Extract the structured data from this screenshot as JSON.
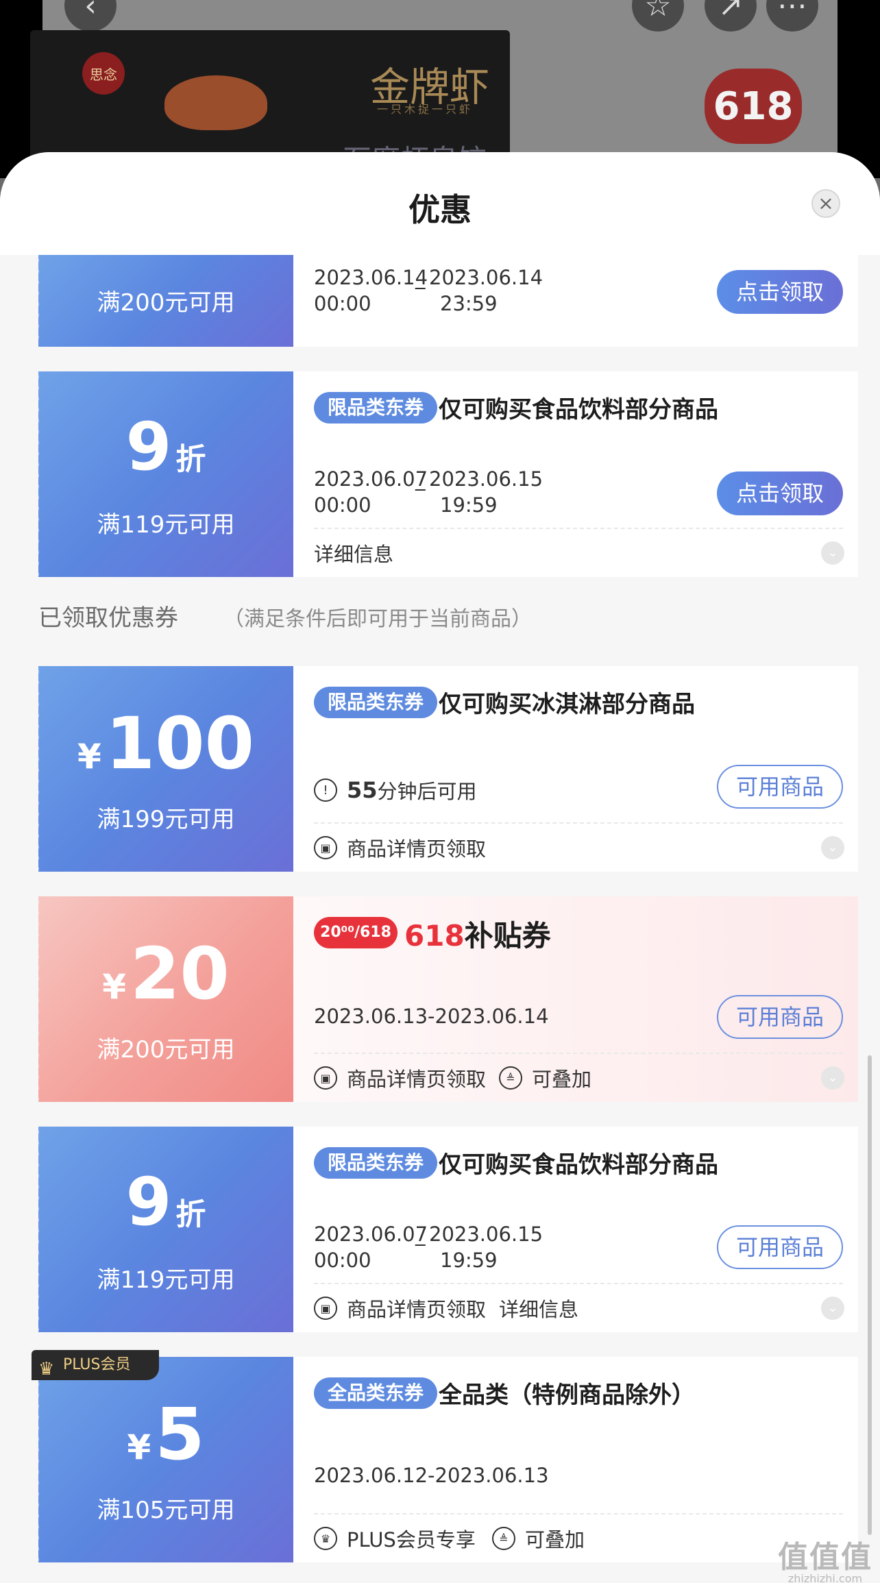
{
  "background": {
    "brand_logo": "思念",
    "product_title": "金牌虾",
    "product_subtitle": "一只木捉一只虾",
    "product_bottom_text": "石磨虾皇饺",
    "badge": "618",
    "back_icon": "chevron-left-icon"
  },
  "sheet": {
    "title": "优惠",
    "close_icon": "close-icon"
  },
  "coupons_claimable": [
    {
      "condition": "满200元可用",
      "date_start": "2023.06.14",
      "time_start": "00:00",
      "date_end": "2023.06.14",
      "time_end": "23:59",
      "button": "点击领取"
    },
    {
      "amount": "9",
      "unit": "折",
      "condition": "满119元可用",
      "tag": "限品类东券",
      "title": "仅可购买食品饮料部分商品",
      "date_start": "2023.06.07",
      "time_start": "00:00",
      "date_end": "2023.06.15",
      "time_end": "19:59",
      "button": "点击领取",
      "detail": "详细信息"
    }
  ],
  "claimed_section": {
    "title": "已领取优惠券",
    "subtitle": "（满足条件后即可用于当前商品）"
  },
  "coupons_claimed": [
    {
      "currency": "¥",
      "amount": "100",
      "condition": "满199元可用",
      "tag": "限品类东券",
      "title": "仅可购买冰淇淋部分商品",
      "countdown_num": "55",
      "countdown_text": "分钟后可用",
      "button": "可用商品",
      "source": "商品详情页领取"
    },
    {
      "currency": "¥",
      "amount": "20",
      "condition": "满200元可用",
      "badge": "20⁰⁰/618",
      "title_red": "618",
      "title_rest": "补贴券",
      "dates": "2023.06.13-2023.06.14",
      "button": "可用商品",
      "source": "商品详情页领取",
      "stackable": "可叠加"
    },
    {
      "amount": "9",
      "unit": "折",
      "condition": "满119元可用",
      "tag": "限品类东券",
      "title": "仅可购买食品饮料部分商品",
      "date_start": "2023.06.07",
      "time_start": "00:00",
      "date_end": "2023.06.15",
      "time_end": "19:59",
      "button": "可用商品",
      "source": "商品详情页领取",
      "detail": "详细信息"
    },
    {
      "plus_badge": "PLUS会员",
      "currency": "¥",
      "amount": "5",
      "condition": "满105元可用",
      "tag": "全品类东券",
      "title": "全品类（特例商品除外）",
      "dates": "2023.06.12-2023.06.13",
      "member_only": "PLUS会员专享",
      "stackable": "可叠加"
    }
  ],
  "watermark": {
    "logo": "值值值",
    "url": "zhizhizhi.com"
  },
  "colors": {
    "coupon_blue_start": "#6fa2e8",
    "coupon_blue_end": "#6a6fd6",
    "coupon_pink": "#f4a09a",
    "accent_red": "#e8323b"
  }
}
